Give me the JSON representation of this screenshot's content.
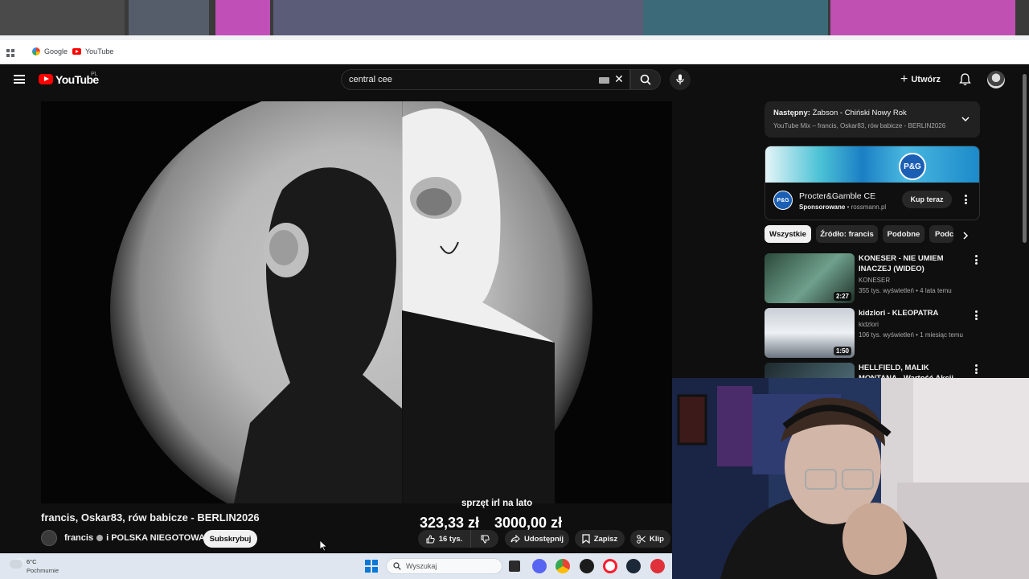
{
  "browser": {
    "bookmarks": [
      {
        "label": "Google",
        "icon": "google-icon"
      },
      {
        "label": "YouTube",
        "icon": "youtube-icon"
      }
    ]
  },
  "header": {
    "logo_text": "YouTube",
    "region": "PL",
    "search_value": "central cee",
    "create_label": "Utwórz"
  },
  "video": {
    "title": "francis, Oskar83, rów babicze - BERLIN2026",
    "channel": "francis",
    "channel_suffix": "i POLSKA NIEGOTOWA",
    "subscribe_label": "Subskrybuj",
    "likes": "16 tys.",
    "share_label": "Udostępnij",
    "save_label": "Zapisz",
    "clip_label": "Klip"
  },
  "overlay": {
    "caption": "sprzęt irl na lato",
    "price_1": "323,33 zł",
    "price_2": "3000,00 zł"
  },
  "sidebar": {
    "next_prefix": "Następny:",
    "next_title": "Żabson - Chiński Nowy Rok",
    "next_sub": "YouTube Mix – francis, Oskar83, rów babicze - BERLIN2026",
    "ad": {
      "logo": "P&G",
      "name": "Procter&Gamble CE",
      "sponsored": "Sponsorowane",
      "domain": "rossmann.pl",
      "buy_label": "Kup teraz"
    },
    "chips": [
      "Wszystkie",
      "Źródło: francis",
      "Podobne",
      "Podc"
    ],
    "recs": [
      {
        "title": "KONESER - NIE UMIEM INACZEJ (WIDEO)",
        "channel": "KONESER",
        "meta": "355 tys. wyświetleń • 4 lata temu",
        "duration": "2:27",
        "colors": [
          "#2c4a3c",
          "#6fa08c"
        ]
      },
      {
        "title": "kidzlori - KLEOPATRA",
        "channel": "kidzlori",
        "meta": "106 tys. wyświetleń • 1 miesiąc temu",
        "duration": "1:50",
        "colors": [
          "#dfe4ea",
          "#9aa3ad"
        ]
      },
      {
        "title": "HELLFIELD, MALIK MONTANA - Wartość Akcji (Official Video)",
        "channel": "",
        "meta": "",
        "duration": "",
        "colors": [
          "#1e2a2e",
          "#4a6670"
        ]
      }
    ]
  },
  "taskbar": {
    "temp": "6°C",
    "weather": "Pochmurnie",
    "search_placeholder": "Wyszukaj"
  },
  "colors": {
    "background": "#0f0f0f",
    "yt_red": "#ff0000",
    "chip_bg": "#272727"
  }
}
